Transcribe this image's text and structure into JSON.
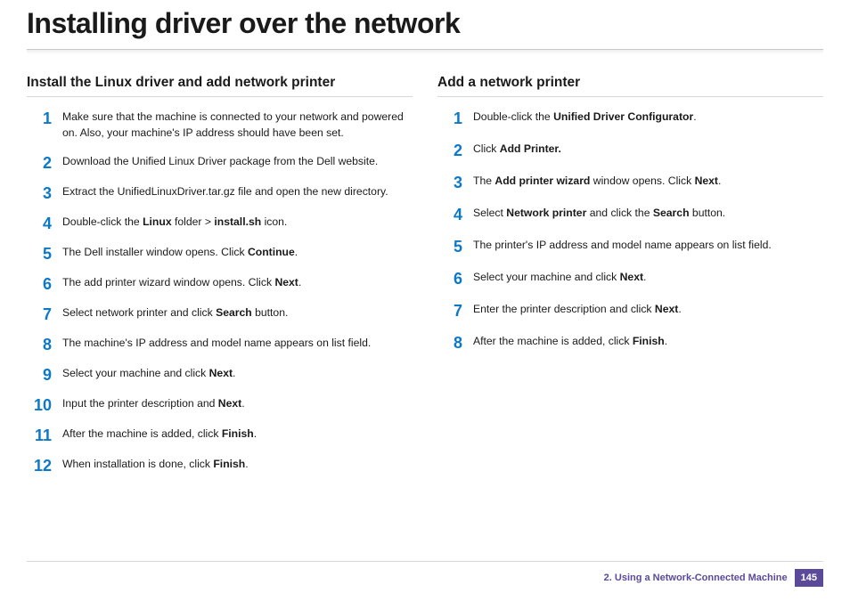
{
  "title": "Installing driver over the network",
  "left": {
    "heading": "Install the Linux driver and add network printer",
    "steps": [
      "Make sure that the machine is connected to your network and powered on. Also, your machine's IP address should have been set.",
      "Download the Unified Linux Driver package from the Dell website.",
      "Extract the UnifiedLinuxDriver.tar.gz file and open the new directory.",
      "Double-click the <b>Linux</b> folder > <b>install.sh</b> icon.",
      "The Dell installer window opens. Click <b>Continue</b>.",
      "The add printer wizard window opens. Click <b>Next</b>.",
      "Select network printer and click <b>Search</b> button.",
      "The machine's IP address and model name appears on list field.",
      "Select your machine and click <b>Next</b>.",
      "Input the printer description and <b>Next</b>.",
      "After the machine is added, click <b>Finish</b>.",
      "When installation is done, click <b>Finish</b>."
    ]
  },
  "right": {
    "heading": "Add a network printer",
    "steps": [
      "Double-click the <b>Unified Driver Configurator</b>.",
      "Click <b>Add Printer.</b>",
      "The <b>Add printer wizard</b> window opens. Click <b>Next</b>.",
      "Select <b>Network printer</b> and click the <b>Search</b> button.",
      "The printer's IP address and model name appears on list field.",
      "Select your machine and click <b>Next</b>.",
      "Enter the printer description and click <b>Next</b>.",
      "After the machine is added, click <b>Finish</b>."
    ]
  },
  "footer": {
    "chapter": "2.  Using a Network-Connected Machine",
    "page": "145"
  }
}
